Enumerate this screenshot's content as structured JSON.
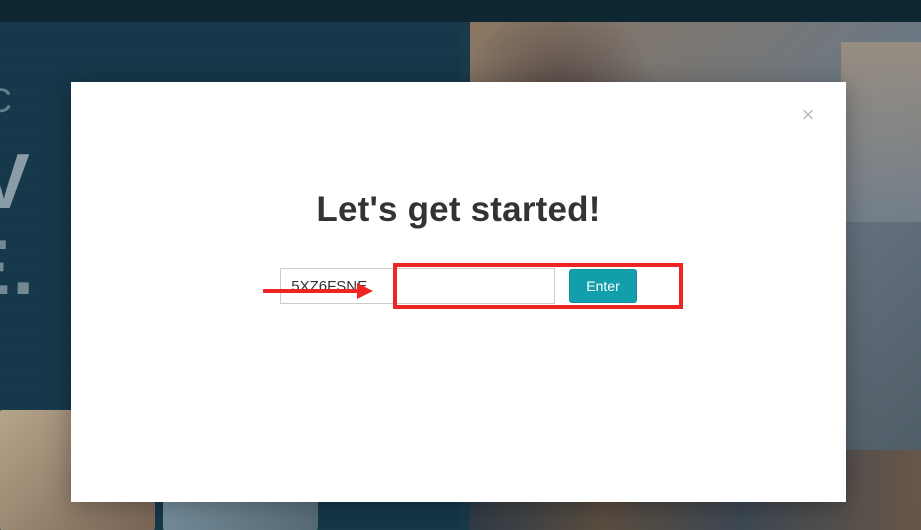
{
  "background": {
    "hero_line1": "RE  SC",
    "hero_line2": "IEV",
    "hero_line3": "RE."
  },
  "modal": {
    "title": "Let's get started!",
    "code_value": "5XZ6FSNE",
    "code_placeholder": "",
    "enter_label": "Enter",
    "close_label": "×"
  },
  "annotation": {
    "arrow_color": "#ef2525",
    "highlight_color": "#ef2525"
  }
}
